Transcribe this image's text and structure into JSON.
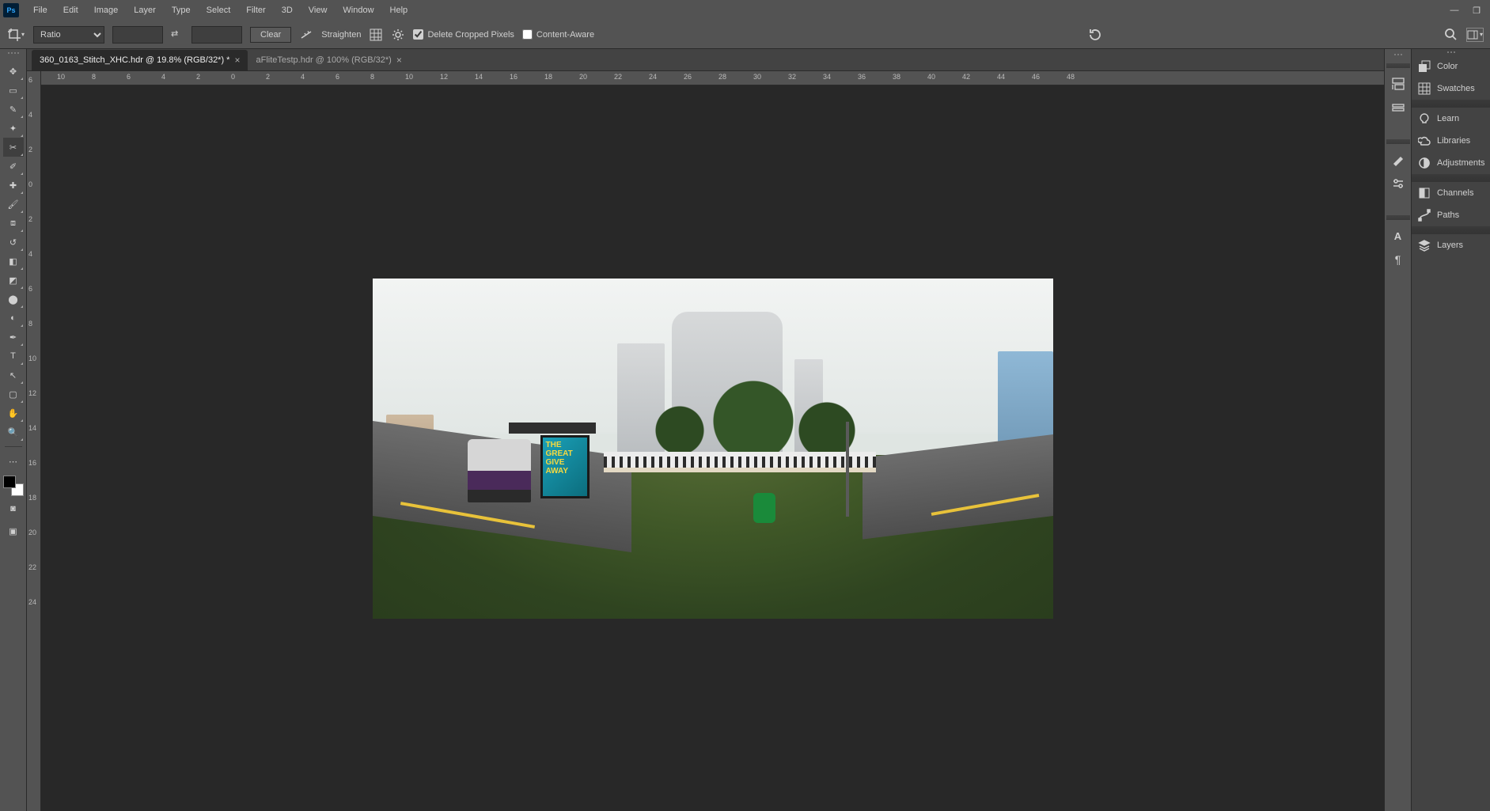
{
  "menubar": {
    "items": [
      "File",
      "Edit",
      "Image",
      "Layer",
      "Type",
      "Select",
      "Filter",
      "3D",
      "View",
      "Window",
      "Help"
    ]
  },
  "optionsbar": {
    "ratio_label": "Ratio",
    "width": "",
    "height": "",
    "clear": "Clear",
    "straighten": "Straighten",
    "delete_cropped": "Delete Cropped Pixels",
    "content_aware": "Content-Aware"
  },
  "tabs": [
    {
      "label": "360_0163_Stitch_XHC.hdr @ 19.8% (RGB/32*) *",
      "active": true
    },
    {
      "label": "aFliteTestp.hdr @ 100% (RGB/32*)",
      "active": false
    }
  ],
  "tools": [
    {
      "name": "move-tool",
      "glyph": "✥"
    },
    {
      "name": "marquee-tool",
      "glyph": "▭"
    },
    {
      "name": "lasso-tool",
      "glyph": "✎"
    },
    {
      "name": "quick-select-tool",
      "glyph": "✦"
    },
    {
      "name": "crop-tool",
      "glyph": "✂",
      "active": true
    },
    {
      "name": "eyedropper-tool",
      "glyph": "✐"
    },
    {
      "name": "healing-tool",
      "glyph": "✚"
    },
    {
      "name": "brush-tool",
      "glyph": "🖌"
    },
    {
      "name": "stamp-tool",
      "glyph": "⧈"
    },
    {
      "name": "history-brush-tool",
      "glyph": "↺"
    },
    {
      "name": "eraser-tool",
      "glyph": "◧"
    },
    {
      "name": "gradient-tool",
      "glyph": "◩"
    },
    {
      "name": "blur-tool",
      "glyph": "⬤"
    },
    {
      "name": "dodge-tool",
      "glyph": "◐"
    },
    {
      "name": "pen-tool",
      "glyph": "✒"
    },
    {
      "name": "type-tool",
      "glyph": "T"
    },
    {
      "name": "path-select-tool",
      "glyph": "↖"
    },
    {
      "name": "rectangle-tool",
      "glyph": "▢"
    },
    {
      "name": "hand-tool",
      "glyph": "✋"
    },
    {
      "name": "zoom-tool",
      "glyph": "🔍"
    }
  ],
  "h_ruler": [
    "10",
    "8",
    "6",
    "4",
    "2",
    "0",
    "2",
    "4",
    "6",
    "8",
    "10",
    "12",
    "14",
    "16",
    "18",
    "20",
    "22",
    "24",
    "26",
    "28",
    "30",
    "32",
    "34",
    "36",
    "38",
    "40",
    "42",
    "44",
    "46",
    "48"
  ],
  "v_ruler": [
    "6",
    "4",
    "2",
    "0",
    "2",
    "4",
    "6",
    "8",
    "10",
    "12",
    "14",
    "16",
    "18",
    "20",
    "22",
    "24"
  ],
  "dock_strip_1": [
    {
      "name": "history-panel-icon"
    },
    {
      "name": "properties-panel-icon"
    }
  ],
  "dock_strip_2": [
    {
      "name": "brush-settings-panel-icon"
    },
    {
      "name": "paragraph-panel-icon"
    },
    {
      "name": "character-panel-icon"
    },
    {
      "name": "glyphs-panel-icon"
    }
  ],
  "panels": [
    {
      "name": "color-panel",
      "label": "Color",
      "glyph": "◧"
    },
    {
      "name": "swatches-panel",
      "label": "Swatches",
      "glyph": "▦"
    },
    {
      "name": "learn-panel",
      "label": "Learn",
      "glyph": "◯",
      "new_group": true
    },
    {
      "name": "libraries-panel",
      "label": "Libraries",
      "glyph": "☁"
    },
    {
      "name": "adjustments-panel",
      "label": "Adjustments",
      "glyph": "◐"
    },
    {
      "name": "channels-panel",
      "label": "Channels",
      "glyph": "◧",
      "new_group": true
    },
    {
      "name": "paths-panel",
      "label": "Paths",
      "glyph": "↝"
    },
    {
      "name": "layers-panel",
      "label": "Layers",
      "glyph": "◈",
      "new_group": true
    }
  ],
  "ad_text": "THE GREAT GIVE AWAY"
}
